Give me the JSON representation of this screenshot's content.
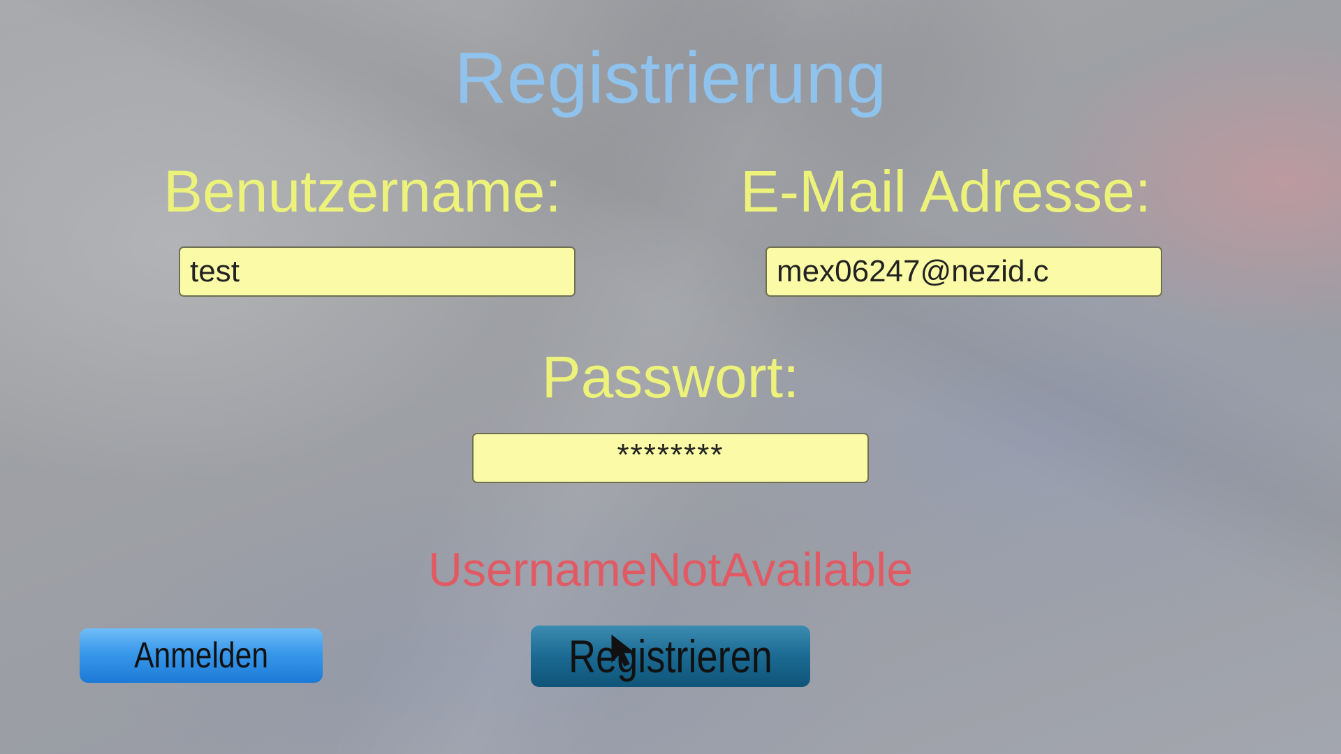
{
  "page": {
    "title": "Registrierung"
  },
  "form": {
    "username_label": "Benutzername:",
    "username_value": "test",
    "email_label": "E-Mail Adresse:",
    "email_value": "mex06247@nezid.c",
    "password_label": "Passwort:",
    "password_value": "********"
  },
  "status": {
    "error_message": "UsernameNotAvailable"
  },
  "buttons": {
    "login_label": "Anmelden",
    "register_label": "Registrieren"
  },
  "colors": {
    "title": "#8fc3ee",
    "labels": "#ecf27a",
    "field_background": "#fbfba7",
    "error": "#e15a63",
    "login_button": "#2f8fe5",
    "register_button": "#1b6a93"
  },
  "icons": {
    "cursor": "mouse-pointer-icon"
  }
}
